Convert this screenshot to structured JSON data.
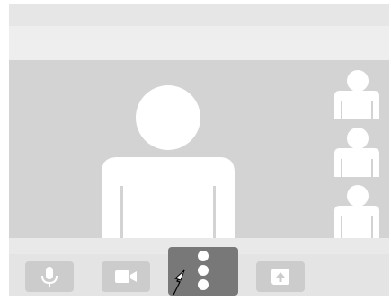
{
  "call": {
    "participants": [
      {
        "icon": "person-silhouette-icon",
        "role": "main"
      },
      {
        "icon": "person-silhouette-icon",
        "role": "thumbnail"
      },
      {
        "icon": "person-silhouette-icon",
        "role": "thumbnail"
      },
      {
        "icon": "person-silhouette-icon",
        "role": "thumbnail"
      }
    ]
  },
  "controls": [
    {
      "icon": "microphone-icon",
      "state": "default"
    },
    {
      "icon": "video-camera-icon",
      "state": "default"
    },
    {
      "icon": "more-options-icon",
      "state": "active"
    },
    {
      "icon": "share-screen-icon",
      "state": "default"
    }
  ],
  "colors": {
    "frame": "#e4e4e4",
    "stage": "#d3d3d3",
    "silhouette": "#ffffff",
    "button": "#cccccc",
    "active_button": "#787878"
  }
}
